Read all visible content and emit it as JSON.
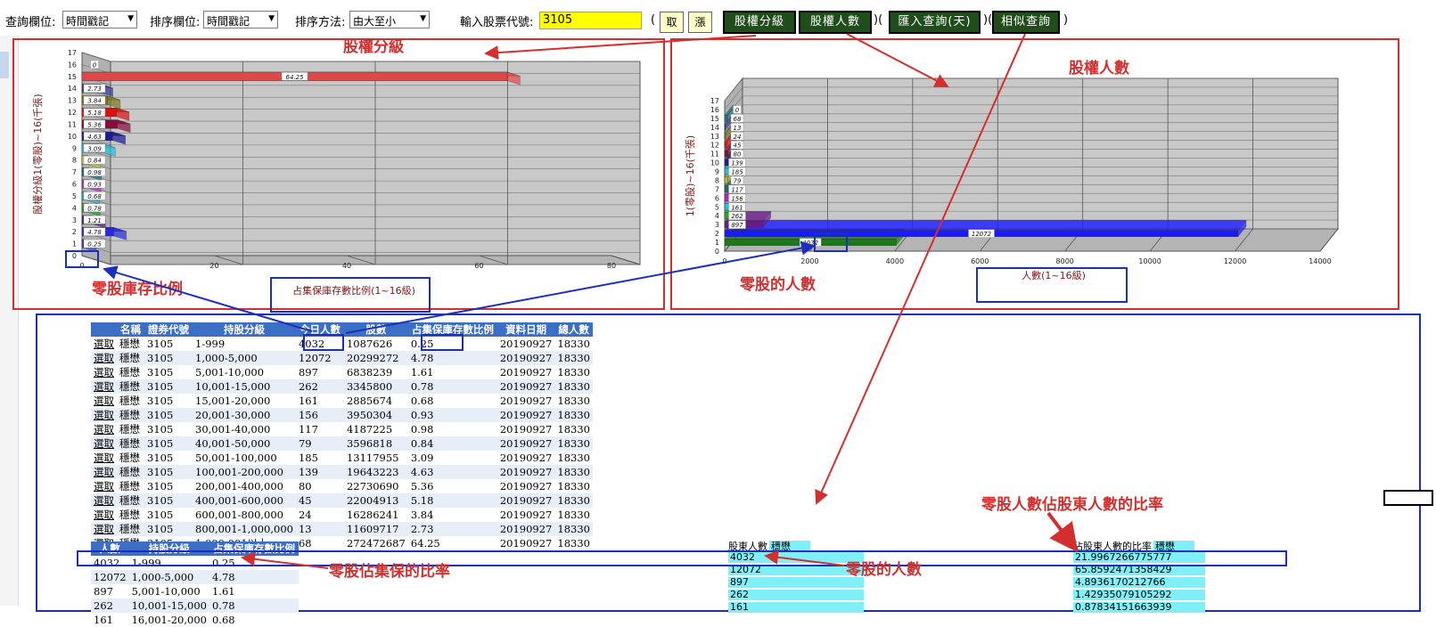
{
  "toolbar": {
    "query_field_label": "查詢欄位:",
    "query_field_value": "時間戳記",
    "sort_field_label": "排序欄位:",
    "sort_field_value": "時間戳記",
    "sort_method_label": "排序方法:",
    "sort_method_value": "由大至小",
    "stock_code_label": "輸入股票代號:",
    "stock_code_value": "3105",
    "btn_fetch": "取",
    "btn_up": "漲",
    "btn_tier": "股權分級",
    "btn_holders": "股權人數",
    "btn_import": "匯入查詢(天)",
    "btn_similar": "相似查詢",
    "paren_open": "(",
    "paren_mid": ")(",
    "paren_close": ")",
    "colors": {
      "button_bg": "#1f4e1a",
      "input_bg": "#ffff00",
      "small_btn_bg": "#ffffc8"
    }
  },
  "annotations": {
    "tier_title": "股權分級",
    "holders_title": "股權人數",
    "odd_lot_ratio": "零股庫存比例",
    "odd_lot_people": "零股的人數",
    "odd_ratio_caption": "零股佔集保的比率",
    "odd_people_caption": "零股的人數",
    "odd_share_of_holders": "零股人數佔股東人數的比率",
    "color": "#d32f2f"
  },
  "chart_data": [
    {
      "type": "bar",
      "orientation": "horizontal",
      "ylabel": "股權分級1(零股)~16(千張)",
      "xlabel": "占集保庫存數比例(1~16級)",
      "categories": [
        "1",
        "2",
        "3",
        "4",
        "5",
        "6",
        "7",
        "8",
        "9",
        "10",
        "11",
        "12",
        "13",
        "14",
        "15",
        "16"
      ],
      "values": [
        0.25,
        4.78,
        1.61,
        0.78,
        0.68,
        0.93,
        0.98,
        0.84,
        3.09,
        4.63,
        5.36,
        5.18,
        3.84,
        2.73,
        64.25,
        0
      ],
      "value_labels": [
        "0.25",
        "4.78",
        "1.21",
        "0.78",
        "0.68",
        "0.93",
        "0.98",
        "0.84",
        "3.09",
        "4.63",
        "5.36",
        "5.18",
        "3.84",
        "2.73",
        "64.25",
        "0"
      ],
      "colors": [
        "#3a3ad0",
        "#2a2adb",
        "#5a1a8a",
        "#1aa01a",
        "#1fb0c0",
        "#c020c0",
        "#1a6a6a",
        "#c8c830",
        "#1fc0e0",
        "#1a1a9a",
        "#8a0a3a",
        "#e01010",
        "#7a7a1a",
        "#3a3aa0",
        "#e04848",
        "#c0c0c0"
      ],
      "xlim": [
        0,
        80
      ],
      "xticks": [
        0,
        20,
        40,
        60,
        80
      ],
      "yticks": [
        0,
        1,
        2,
        3,
        4,
        5,
        6,
        7,
        8,
        9,
        10,
        11,
        12,
        13,
        14,
        15,
        16,
        17
      ],
      "grid": true
    },
    {
      "type": "bar",
      "orientation": "horizontal",
      "ylabel": "1(零股)~16(千張)",
      "xlabel": "人數(1~16級)",
      "categories": [
        "1",
        "2",
        "3",
        "4",
        "5",
        "6",
        "7",
        "8",
        "9",
        "10",
        "11",
        "12",
        "13",
        "14",
        "15",
        "16"
      ],
      "values": [
        4032,
        12072,
        897,
        262,
        161,
        156,
        117,
        79,
        185,
        139,
        80,
        45,
        24,
        13,
        68,
        0
      ],
      "value_labels": [
        "4032",
        "12072",
        "897",
        "262",
        "161",
        "156",
        "117",
        "79",
        "185",
        "139",
        "80",
        "45",
        "24",
        "13",
        "68",
        "0"
      ],
      "colors": [
        "#1a7a1a",
        "#1a1aff",
        "#6a1a8a",
        "#1ab01a",
        "#1fc0e0",
        "#c020c0",
        "#1a6a6a",
        "#b8b830",
        "#1fc0e0",
        "#1a1a9a",
        "#8a0a3a",
        "#e01010",
        "#7a7a1a",
        "#3a3aa0",
        "#1a7a8a",
        "#c0c0c0"
      ],
      "xlim": [
        0,
        14000
      ],
      "xticks": [
        0,
        2000,
        4000,
        6000,
        8000,
        10000,
        12000,
        14000
      ],
      "yticks": [
        0,
        1,
        2,
        3,
        4,
        5,
        6,
        7,
        8,
        9,
        10,
        11,
        12,
        13,
        14,
        15,
        16,
        17
      ],
      "grid": true
    }
  ],
  "left_chart_axes": {
    "xticks": [
      "0",
      "20",
      "40",
      "60",
      "80"
    ],
    "yticks": [
      "0",
      "1",
      "2",
      "3",
      "4",
      "5",
      "6",
      "7",
      "8",
      "9",
      "10",
      "11",
      "12",
      "13",
      "14",
      "15",
      "16",
      "17"
    ]
  },
  "right_chart_axes": {
    "xticks": [
      "0",
      "2000",
      "4000",
      "6000",
      "8000",
      "10000",
      "12000",
      "14000"
    ],
    "yticks": [
      "0",
      "1",
      "2",
      "3",
      "4",
      "5",
      "6",
      "7",
      "8",
      "9",
      "10",
      "11",
      "12",
      "13",
      "14",
      "15",
      "16",
      "17"
    ]
  },
  "main_table": {
    "headers": [
      "",
      "名稱",
      "證券代號",
      "持股分級",
      "今日人數",
      "股數",
      "占集保庫存數比例",
      "資料日期",
      "總人數"
    ],
    "rows": [
      [
        "選取",
        "穩懋",
        "3105",
        "1-999",
        "4032",
        "1087626",
        "0.25",
        "20190927",
        "18330"
      ],
      [
        "選取",
        "穩懋",
        "3105",
        "1,000-5,000",
        "12072",
        "20299272",
        "4.78",
        "20190927",
        "18330"
      ],
      [
        "選取",
        "穩懋",
        "3105",
        "5,001-10,000",
        "897",
        "6838239",
        "1.61",
        "20190927",
        "18330"
      ],
      [
        "選取",
        "穩懋",
        "3105",
        "10,001-15,000",
        "262",
        "3345800",
        "0.78",
        "20190927",
        "18330"
      ],
      [
        "選取",
        "穩懋",
        "3105",
        "15,001-20,000",
        "161",
        "2885674",
        "0.68",
        "20190927",
        "18330"
      ],
      [
        "選取",
        "穩懋",
        "3105",
        "20,001-30,000",
        "156",
        "3950304",
        "0.93",
        "20190927",
        "18330"
      ],
      [
        "選取",
        "穩懋",
        "3105",
        "30,001-40,000",
        "117",
        "4187225",
        "0.98",
        "20190927",
        "18330"
      ],
      [
        "選取",
        "穩懋",
        "3105",
        "40,001-50,000",
        "79",
        "3596818",
        "0.84",
        "20190927",
        "18330"
      ],
      [
        "選取",
        "穩懋",
        "3105",
        "50,001-100,000",
        "185",
        "13117955",
        "3.09",
        "20190927",
        "18330"
      ],
      [
        "選取",
        "穩懋",
        "3105",
        "100,001-200,000",
        "139",
        "19643223",
        "4.63",
        "20190927",
        "18330"
      ],
      [
        "選取",
        "穩懋",
        "3105",
        "200,001-400,000",
        "80",
        "22730690",
        "5.36",
        "20190927",
        "18330"
      ],
      [
        "選取",
        "穩懋",
        "3105",
        "400,001-600,000",
        "45",
        "22004913",
        "5.18",
        "20190927",
        "18330"
      ],
      [
        "選取",
        "穩懋",
        "3105",
        "600,001-800,000",
        "24",
        "16286241",
        "3.84",
        "20190927",
        "18330"
      ],
      [
        "選取",
        "穩懋",
        "3105",
        "800,001-1,000,000",
        "13",
        "11609717",
        "2.73",
        "20190927",
        "18330"
      ],
      [
        "選取",
        "穩懋",
        "3105",
        "1,000,001以上",
        "68",
        "272472687",
        "64.25",
        "20190927",
        "18330"
      ]
    ]
  },
  "small_table": {
    "headers": [
      "人數",
      "持股分級",
      "占集保庫存數比例"
    ],
    "rows": [
      [
        "4032",
        "1-999",
        "0.25"
      ],
      [
        "12072",
        "1,000-5,000",
        "4.78"
      ],
      [
        "897",
        "5,001-10,000",
        "1.61"
      ],
      [
        "262",
        "10,001-15,000",
        "0.78"
      ],
      [
        "161",
        "16,001-20,000",
        "0.68"
      ]
    ]
  },
  "holders_list": {
    "header": "股東人數",
    "header_tag": "穩懋",
    "values": [
      "4032",
      "12072",
      "897",
      "262",
      "161"
    ]
  },
  "ratio_list": {
    "header": "佔股東人數的比率",
    "header_tag": "穩懋",
    "values": [
      "21.9967266775777",
      "65.8592471358429",
      "4.8936170212766",
      "1.42935079105292",
      "0.87834151663939"
    ]
  }
}
